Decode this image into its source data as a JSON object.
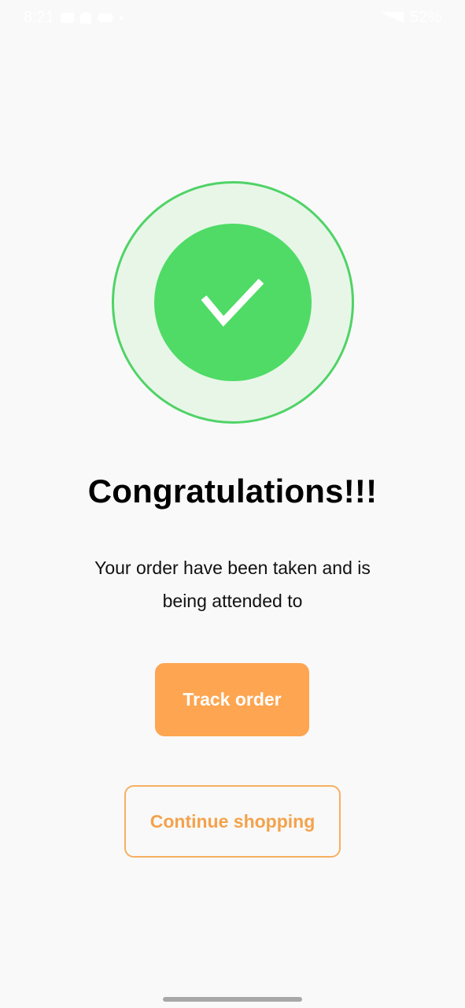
{
  "status_bar": {
    "time": "8:21",
    "battery": "52%"
  },
  "success": {
    "title": "Congratulations!!!",
    "message": "Your order have been taken and is being attended to"
  },
  "actions": {
    "track_order": "Track order",
    "continue_shopping": "Continue shopping"
  },
  "colors": {
    "success_green": "#4fdb66",
    "accent_orange": "#fda550"
  },
  "icons": {
    "badge": "checkmark-icon"
  }
}
